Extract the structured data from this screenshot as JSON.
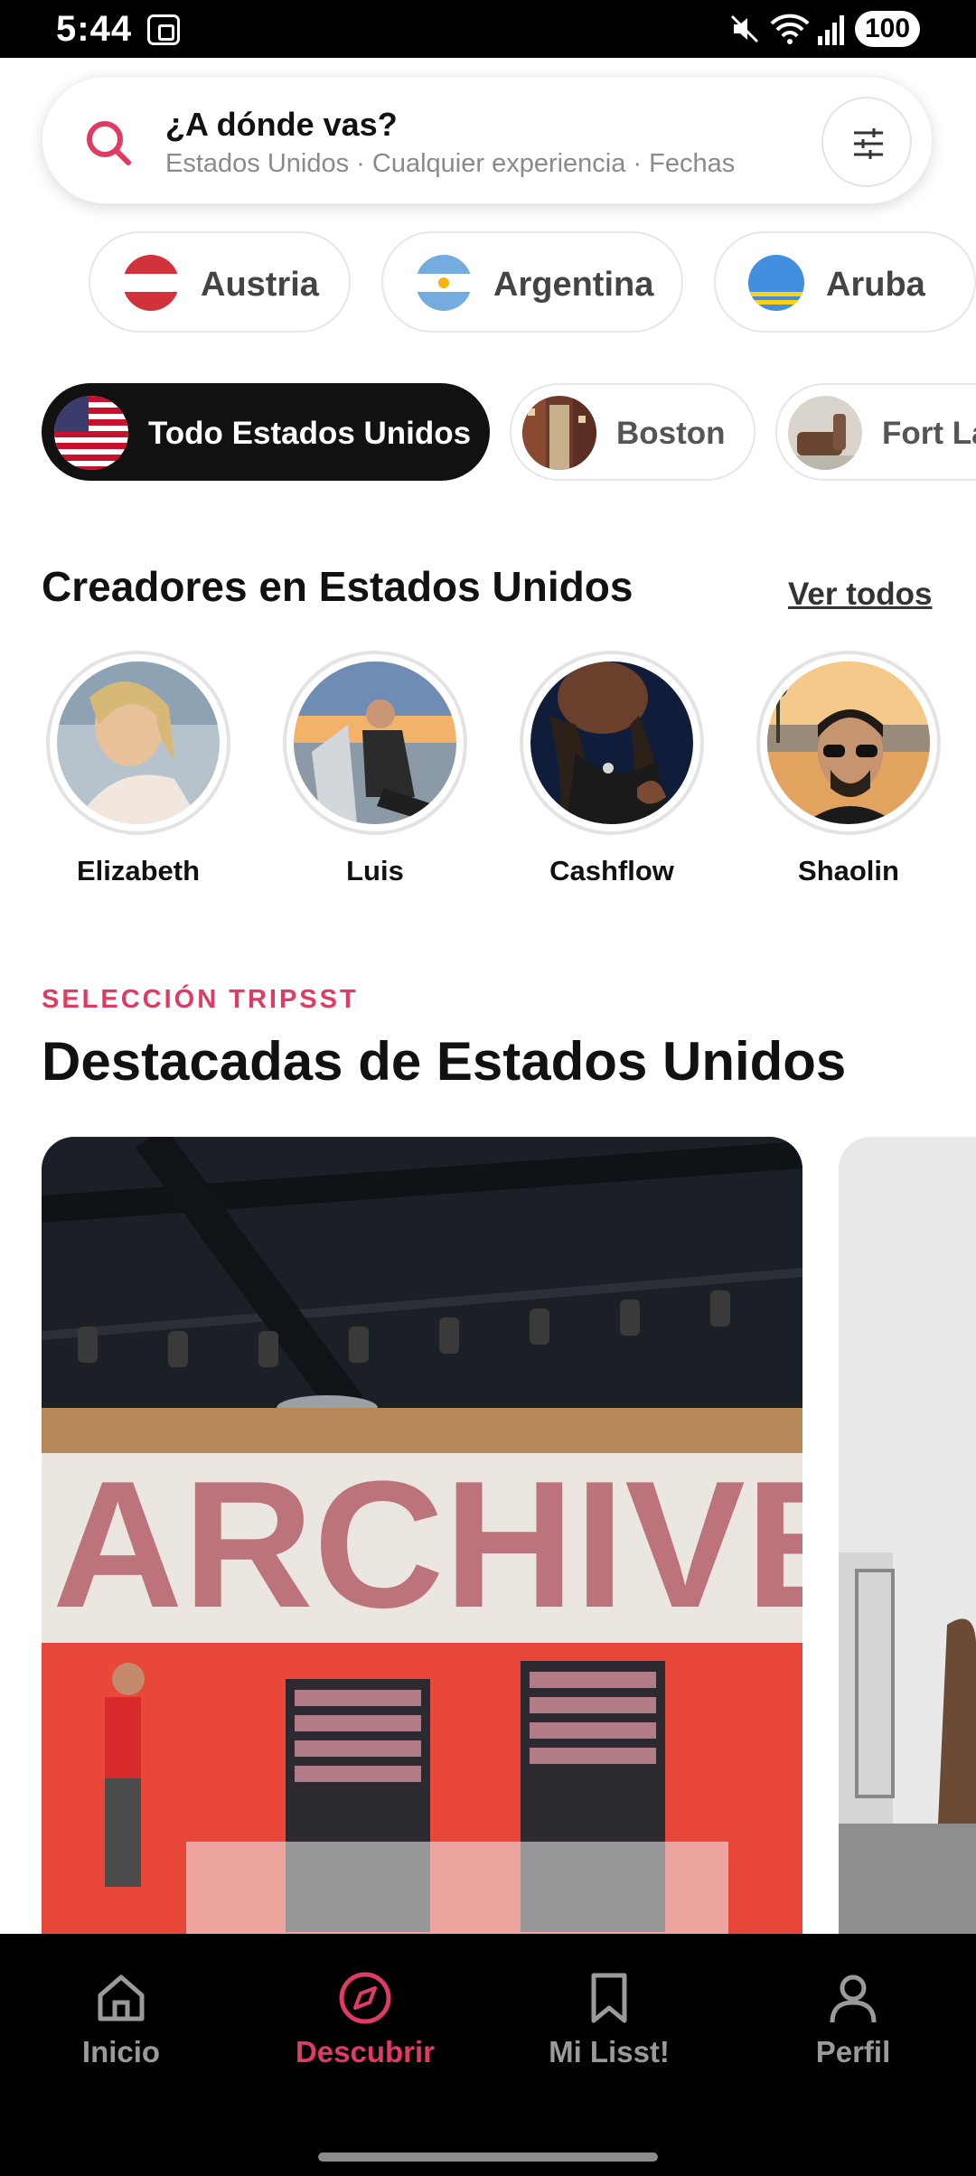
{
  "status_bar": {
    "time": "5:44",
    "battery": "100"
  },
  "search": {
    "title": "¿A dónde vas?",
    "subtitle": "Estados Unidos · Cualquier experiencia · Fechas",
    "accent_color": "#e03b62"
  },
  "countries": [
    {
      "label": "Austria",
      "flag": "austria-flag-icon"
    },
    {
      "label": "Argentina",
      "flag": "argentina-flag-icon"
    },
    {
      "label": "Aruba",
      "flag": "aruba-flag-icon"
    }
  ],
  "cities": [
    {
      "label": "Todo Estados Unidos",
      "active": true
    },
    {
      "label": "Boston",
      "active": false
    },
    {
      "label": "Fort La",
      "active": false
    }
  ],
  "creators": {
    "title": "Creadores en Estados Unidos",
    "see_all": "Ver todos",
    "items": [
      {
        "name": "Elizabeth"
      },
      {
        "name": "Luis"
      },
      {
        "name": "Cashflow"
      },
      {
        "name": "Shaolin"
      }
    ]
  },
  "featured": {
    "eyebrow": "SELECCIÓN TRIPSST",
    "title": "Destacadas de Estados Unidos",
    "card_sign_text": "ARCHIVE"
  },
  "nav": {
    "items": [
      {
        "label": "Inicio",
        "icon": "home-icon",
        "active": false
      },
      {
        "label": "Descubrir",
        "icon": "compass-icon",
        "active": true
      },
      {
        "label": "Mi Lisst!",
        "icon": "bookmark-icon",
        "active": false
      },
      {
        "label": "Perfil",
        "icon": "user-icon",
        "active": false
      }
    ]
  }
}
